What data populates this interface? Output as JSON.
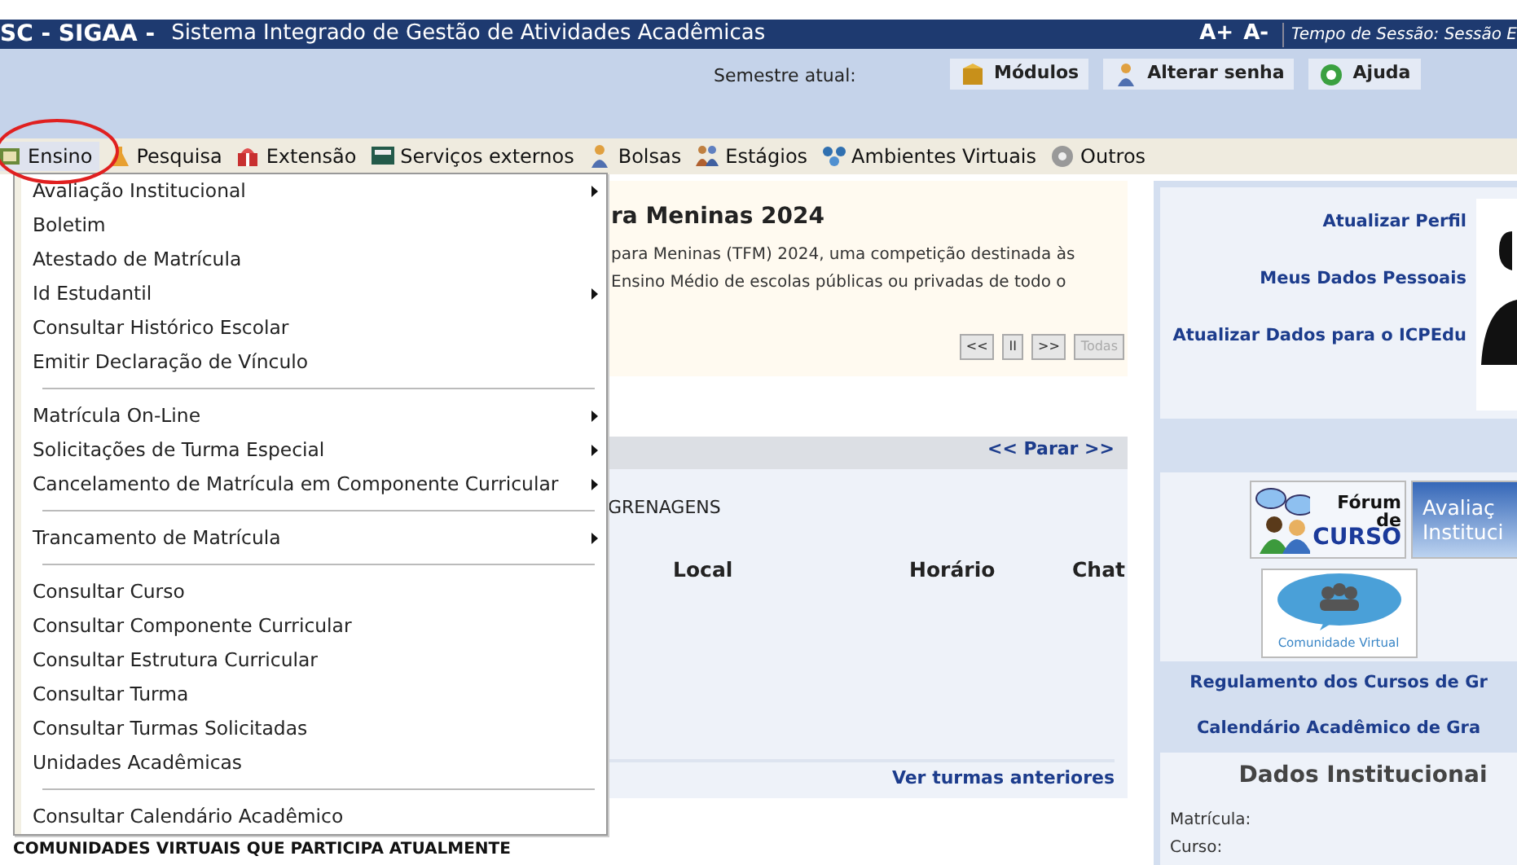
{
  "header": {
    "system": "SC - SIGAA -",
    "title": "Sistema Integrado de Gestão de Atividades Acadêmicas",
    "font_controls": [
      "A+",
      "A-"
    ],
    "session_label": "Tempo de Sessão:",
    "session_value": "Sessão E"
  },
  "toolbar": {
    "semester_label": "Semestre atual:",
    "buttons": [
      {
        "label": "Módulos",
        "kind": "box"
      },
      {
        "label": "Alterar senha",
        "kind": "person"
      },
      {
        "label": "Ajuda",
        "kind": "help"
      }
    ]
  },
  "menu_bar": [
    {
      "label": "Ensino",
      "kind": "book",
      "selected": true
    },
    {
      "label": "Pesquisa",
      "kind": "flask",
      "selected": false
    },
    {
      "label": "Extensão",
      "kind": "gift",
      "selected": false
    },
    {
      "label": "Serviços externos",
      "kind": "monitor",
      "selected": false
    },
    {
      "label": "Bolsas",
      "kind": "person",
      "selected": false
    },
    {
      "label": "Estágios",
      "kind": "people",
      "selected": false
    },
    {
      "label": "Ambientes Virtuais",
      "kind": "network",
      "selected": false
    },
    {
      "label": "Outros",
      "kind": "gear",
      "selected": false
    }
  ],
  "dropdown": [
    [
      {
        "label": "Avaliação Institucional",
        "has_submenu": true
      },
      {
        "label": "Boletim",
        "has_submenu": false
      },
      {
        "label": "Atestado de Matrícula",
        "has_submenu": false
      },
      {
        "label": "Id Estudantil",
        "has_submenu": true
      },
      {
        "label": "Consultar Histórico Escolar",
        "has_submenu": false
      },
      {
        "label": "Emitir Declaração de Vínculo",
        "has_submenu": false
      }
    ],
    [
      {
        "label": "Matrícula On-Line",
        "has_submenu": true
      },
      {
        "label": "Solicitações de Turma Especial",
        "has_submenu": true
      },
      {
        "label": "Cancelamento de Matrícula em Componente Curricular",
        "has_submenu": true
      }
    ],
    [
      {
        "label": "Trancamento de Matrícula",
        "has_submenu": true
      }
    ],
    [
      {
        "label": "Consultar Curso",
        "has_submenu": false
      },
      {
        "label": "Consultar Componente Curricular",
        "has_submenu": false
      },
      {
        "label": "Consultar Estrutura Curricular",
        "has_submenu": false
      },
      {
        "label": "Consultar Turma",
        "has_submenu": false
      },
      {
        "label": "Consultar Turmas Solicitadas",
        "has_submenu": false
      },
      {
        "label": "Unidades Acadêmicas",
        "has_submenu": false
      }
    ],
    [
      {
        "label": "Consultar Calendário Acadêmico",
        "has_submenu": false
      }
    ]
  ],
  "notice": {
    "title": "ra Meninas 2024",
    "lines": [
      "para Meninas (TFM) 2024, uma competição destinada às",
      "Ensino Médio de escolas públicas ou privadas de todo o"
    ],
    "controls": [
      {
        "label": "<<",
        "disabled": false
      },
      {
        "label": "II",
        "disabled": false
      },
      {
        "label": ">>",
        "disabled": false
      },
      {
        "label": "Todas",
        "disabled": true
      }
    ]
  },
  "classes": {
    "nav": "<< Parar >>",
    "item": "GRENAGENS",
    "columns": [
      "Local",
      "Horário",
      "Chat"
    ],
    "footer_link": "Ver turmas anteriores"
  },
  "communities_heading": "COMUNIDADES VIRTUAIS QUE PARTICIPA ATUALMENTE",
  "profile": {
    "links": [
      "Atualizar Perfil",
      "Meus Dados Pessoais",
      "Atualizar Dados para o ICPEdu"
    ]
  },
  "banners": [
    {
      "kind": "forum",
      "lines": [
        "Fórum",
        "de",
        "CURSO"
      ]
    },
    {
      "kind": "evaluation",
      "lines": [
        "Avaliaç",
        "Instituci"
      ]
    },
    {
      "kind": "community",
      "lines": [
        "Comunidade Virtual"
      ]
    }
  ],
  "links": [
    "Regulamento dos Cursos de Gr",
    "Calendário Acadêmico de Gra"
  ],
  "institutional": {
    "title": "Dados Institucionai",
    "fields": [
      "Matrícula:",
      "Curso:"
    ]
  }
}
